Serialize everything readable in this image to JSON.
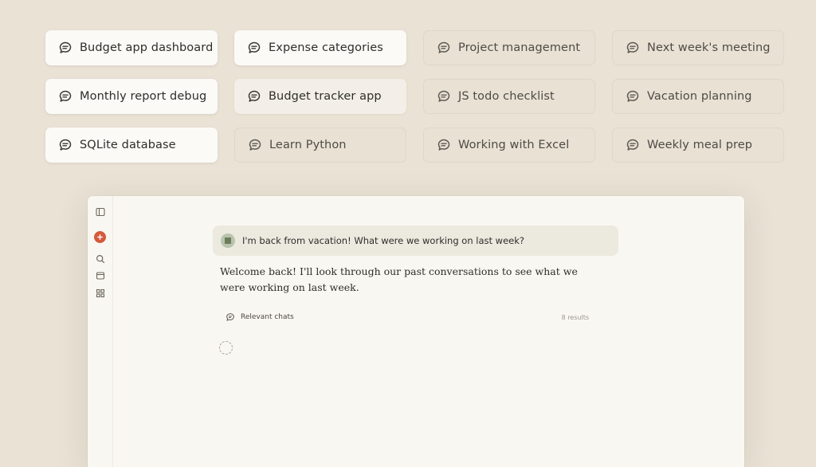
{
  "chips": [
    {
      "label": "Budget app dashboard",
      "style": "bright"
    },
    {
      "label": "Expense categories",
      "style": "bright"
    },
    {
      "label": "Project management",
      "style": "dim"
    },
    {
      "label": "Next week's meeting",
      "style": "dim"
    },
    {
      "label": "Monthly report debug",
      "style": "bright"
    },
    {
      "label": "Budget tracker app",
      "style": "mid"
    },
    {
      "label": "JS todo checklist",
      "style": "dim"
    },
    {
      "label": "Vacation planning",
      "style": "dim"
    },
    {
      "label": "SQLite database",
      "style": "bright"
    },
    {
      "label": "Learn Python",
      "style": "dim"
    },
    {
      "label": "Working with Excel",
      "style": "dim"
    },
    {
      "label": "Weekly meal prep",
      "style": "dim"
    }
  ],
  "chat": {
    "user_message": "I'm back from vacation! What were we working on last week?",
    "assistant_message": "Welcome back! I'll look through our past conversations to see what we were working on last week.",
    "tool_label": "Relevant chats",
    "tool_results": "8 results"
  },
  "sidebar_icons": [
    "sidebar-toggle-icon",
    "new-chat-icon",
    "search-icon",
    "chats-icon",
    "projects-icon"
  ],
  "colors": {
    "background": "#e9e2d5",
    "accent": "#d35a3b",
    "window": "#f9f7f2"
  }
}
